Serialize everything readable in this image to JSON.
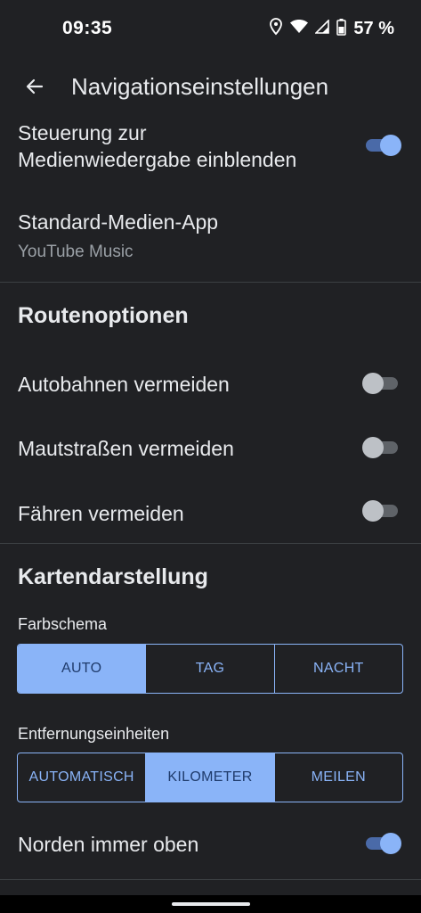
{
  "status": {
    "time": "09:35",
    "battery": "57 %"
  },
  "header": {
    "title": "Navigationseinstellungen"
  },
  "media": {
    "show_controls_label": "Steuerung zur\nMedienwiedergabe einblenden",
    "show_controls_on": true,
    "default_app_label": "Standard-Medien-App",
    "default_app_value": "YouTube Music"
  },
  "routes": {
    "title": "Routenoptionen",
    "items": [
      {
        "label": "Autobahnen vermeiden",
        "on": false
      },
      {
        "label": "Mautstraßen vermeiden",
        "on": false
      },
      {
        "label": "Fähren vermeiden",
        "on": false
      }
    ]
  },
  "map": {
    "title": "Kartendarstellung",
    "color_scheme_label": "Farbschema",
    "color_scheme_options": [
      "AUTO",
      "TAG",
      "NACHT"
    ],
    "color_scheme_selected": "AUTO",
    "distance_label": "Entfernungseinheiten",
    "distance_options": [
      "AUTOMATISCH",
      "KILOMETER",
      "MEILEN"
    ],
    "distance_selected": "KILOMETER",
    "north_up_label": "Norden immer oben",
    "north_up_on": true
  },
  "colors": {
    "background": "#202124",
    "accent": "#8ab4f8",
    "text": "#e8eaed",
    "subtext": "#9aa0a6"
  },
  "icons": [
    "location-icon",
    "wifi-icon",
    "signal-icon",
    "battery-icon",
    "back-arrow-icon"
  ]
}
